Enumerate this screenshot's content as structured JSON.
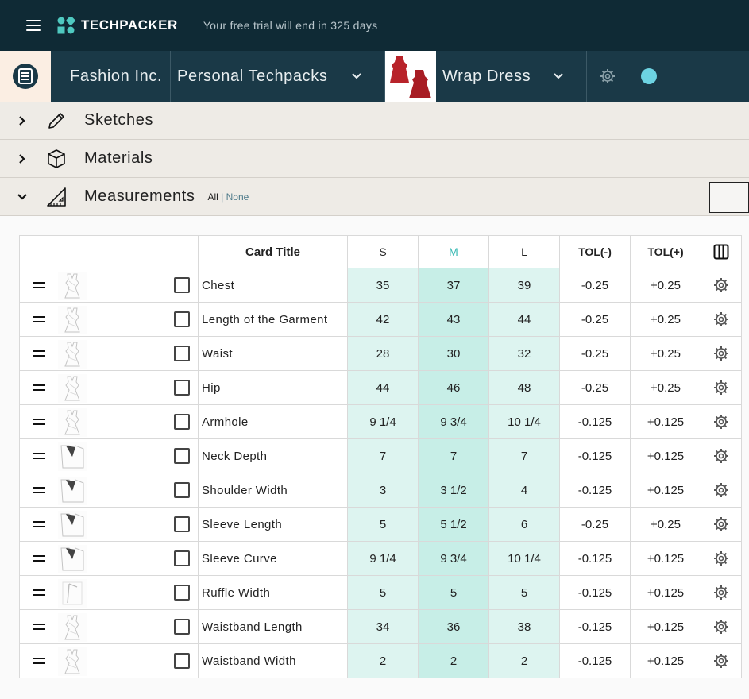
{
  "topbar": {
    "brand": "TECHPACKER",
    "trial_notice": "Your free trial will end in 325 days"
  },
  "context": {
    "company": "Fashion Inc.",
    "techpacks": "Personal Techpacks",
    "product": "Wrap Dress",
    "status_color": "#6dd3e2"
  },
  "sections": {
    "sketches": "Sketches",
    "materials": "Materials",
    "measurements": "Measurements",
    "filter_all": "All",
    "filter_sep": " | ",
    "filter_none": "None"
  },
  "table": {
    "headers": {
      "title": "Card Title",
      "s": "S",
      "m": "M",
      "l": "L",
      "tol_minus": "TOL(-)",
      "tol_plus": "TOL(+)"
    },
    "rows": [
      {
        "title": "Chest",
        "s": "35",
        "m": "37",
        "l": "39",
        "tol_minus": "-0.25",
        "tol_plus": "+0.25",
        "thumb": "dress"
      },
      {
        "title": "Length of the Garment",
        "s": "42",
        "m": "43",
        "l": "44",
        "tol_minus": "-0.25",
        "tol_plus": "+0.25",
        "thumb": "dress"
      },
      {
        "title": "Waist",
        "s": "28",
        "m": "30",
        "l": "32",
        "tol_minus": "-0.25",
        "tol_plus": "+0.25",
        "thumb": "dress"
      },
      {
        "title": "Hip",
        "s": "44",
        "m": "46",
        "l": "48",
        "tol_minus": "-0.25",
        "tol_plus": "+0.25",
        "thumb": "dress"
      },
      {
        "title": "Armhole",
        "s": "9 1/4",
        "m": "9 3/4",
        "l": "10 1/4",
        "tol_minus": "-0.125",
        "tol_plus": "+0.125",
        "thumb": "dress"
      },
      {
        "title": "Neck Depth",
        "s": "7",
        "m": "7",
        "l": "7",
        "tol_minus": "-0.125",
        "tol_plus": "+0.125",
        "thumb": "neck"
      },
      {
        "title": "Shoulder Width",
        "s": "3",
        "m": "3 1/2",
        "l": "4",
        "tol_minus": "-0.125",
        "tol_plus": "+0.125",
        "thumb": "neck"
      },
      {
        "title": "Sleeve Length",
        "s": "5",
        "m": "5 1/2",
        "l": "6",
        "tol_minus": "-0.25",
        "tol_plus": "+0.25",
        "thumb": "neck"
      },
      {
        "title": "Sleeve Curve",
        "s": "9 1/4",
        "m": "9 3/4",
        "l": "10 1/4",
        "tol_minus": "-0.125",
        "tol_plus": "+0.125",
        "thumb": "neck"
      },
      {
        "title": "Ruffle Width",
        "s": "5",
        "m": "5",
        "l": "5",
        "tol_minus": "-0.125",
        "tol_plus": "+0.125",
        "thumb": "ruffle"
      },
      {
        "title": "Waistband Length",
        "s": "34",
        "m": "36",
        "l": "38",
        "tol_minus": "-0.125",
        "tol_plus": "+0.125",
        "thumb": "dress"
      },
      {
        "title": "Waistband Width",
        "s": "2",
        "m": "2",
        "l": "2",
        "tol_minus": "-0.125",
        "tol_plus": "+0.125",
        "thumb": "dress"
      }
    ]
  }
}
